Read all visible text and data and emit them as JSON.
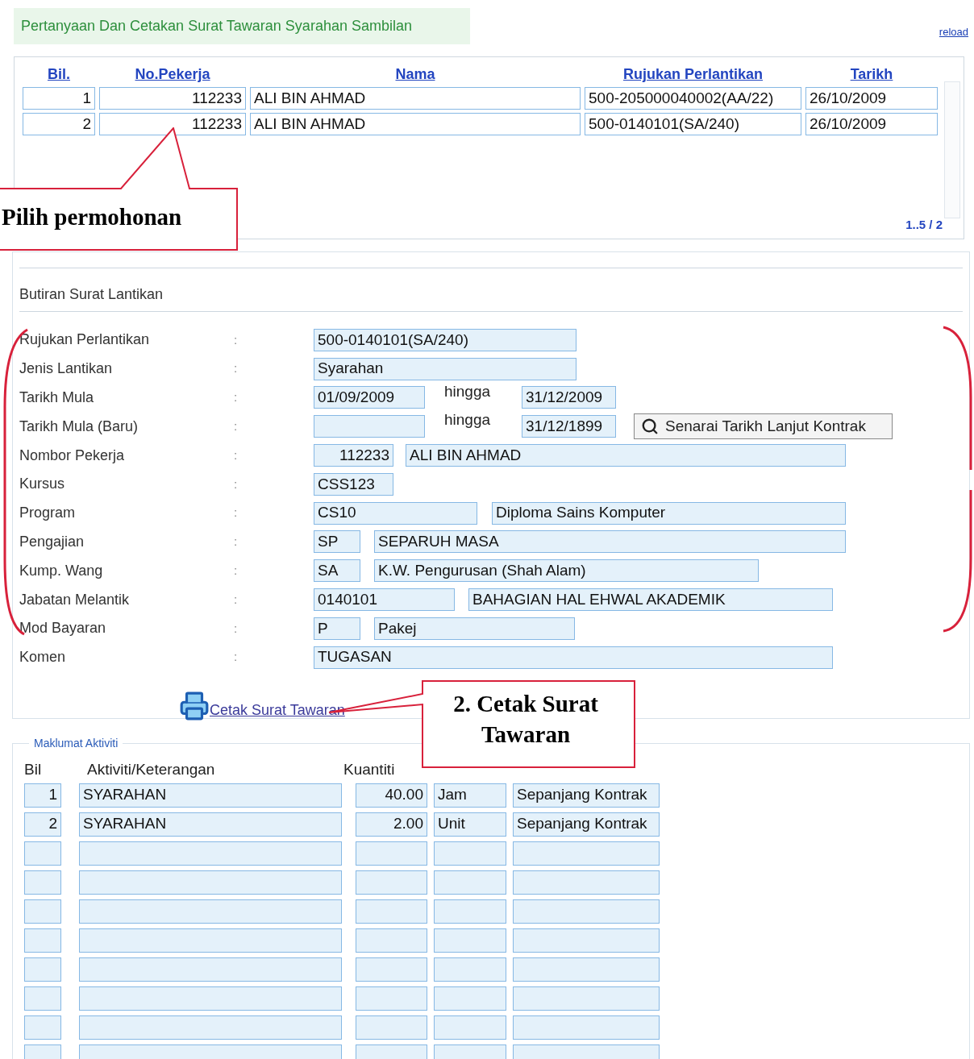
{
  "header": {
    "title": "Pertanyaan Dan Cetakan Surat Tawaran Syarahan Sambilan",
    "reload": "reload"
  },
  "list": {
    "columns": [
      "Bil.",
      "No.Pekerja",
      "Nama",
      "Rujukan Perlantikan",
      "Tarikh"
    ],
    "rows": [
      {
        "cells": [
          "1",
          "112233",
          "ALI BIN AHMAD",
          "500-205000040002(AA/22)",
          "26/10/2009"
        ]
      },
      {
        "cells": [
          "2",
          "112233",
          "ALI BIN AHMAD",
          "500-0140101(SA/240)",
          "26/10/2009"
        ]
      }
    ],
    "pager": "1..5 / 2"
  },
  "details": {
    "title": "Butiran Surat Lantikan",
    "fields": [
      {
        "label": "Rujukan Perlantikan",
        "colon": ":",
        "parts": [
          {
            "kind": "input",
            "value": "500-0140101(SA/240)"
          }
        ]
      },
      {
        "label": "Jenis Lantikan",
        "colon": ":",
        "parts": [
          {
            "kind": "input",
            "value": "Syarahan"
          }
        ]
      },
      {
        "label": "Tarikh Mula",
        "colon": ":",
        "parts": [
          {
            "kind": "input",
            "value": "01/09/2009"
          },
          {
            "kind": "text",
            "value": "hingga"
          },
          {
            "kind": "input",
            "value": "31/12/2009"
          }
        ]
      },
      {
        "label": "Tarikh Mula (Baru)",
        "colon": ":",
        "parts": [
          {
            "kind": "input"
          },
          {
            "kind": "text",
            "value": "hingga"
          },
          {
            "kind": "input",
            "value": "31/12/1899"
          },
          {
            "kind": "button",
            "value": "Senarai Tarikh Lanjut Kontrak"
          }
        ]
      },
      {
        "label": "Nombor Pekerja",
        "colon": ":",
        "parts": [
          {
            "kind": "number",
            "value": "112233"
          },
          {
            "kind": "input",
            "value": "ALI BIN AHMAD"
          }
        ]
      },
      {
        "label": "Kursus",
        "colon": ":",
        "parts": [
          {
            "kind": "input",
            "value": "CSS123"
          }
        ]
      },
      {
        "label": "Program",
        "colon": ":",
        "parts": [
          {
            "kind": "input",
            "value": "CS10"
          },
          {
            "kind": "input",
            "value": "Diploma Sains Komputer"
          }
        ]
      },
      {
        "label": "Pengajian",
        "colon": ":",
        "parts": [
          {
            "kind": "input",
            "value": "SP"
          },
          {
            "kind": "input",
            "value": "SEPARUH MASA"
          }
        ]
      },
      {
        "label": "Kump. Wang",
        "colon": ":",
        "parts": [
          {
            "kind": "input",
            "value": "SA"
          },
          {
            "kind": "input",
            "value": "K.W. Pengurusan (Shah Alam)"
          }
        ]
      },
      {
        "label": "Jabatan Melantik",
        "colon": ":",
        "parts": [
          {
            "kind": "input",
            "value": "0140101"
          },
          {
            "kind": "input",
            "value": "BAHAGIAN HAL EHWAL AKADEMIK"
          }
        ]
      },
      {
        "label": "Mod Bayaran",
        "colon": ":",
        "parts": [
          {
            "kind": "input",
            "value": "P"
          },
          {
            "kind": "input",
            "value": "Pakej"
          }
        ]
      },
      {
        "label": "Komen",
        "colon": ":",
        "parts": [
          {
            "kind": "input",
            "value": "TUGASAN"
          }
        ]
      }
    ],
    "print_link": "Cetak Surat Tawaran"
  },
  "activities": {
    "legend": "Maklumat Aktiviti",
    "columns": [
      "Bil",
      "Aktiviti/Keterangan",
      "Kuantiti"
    ],
    "rows": [
      {
        "kind": "filled",
        "bil": "1",
        "activity": "SYARAHAN",
        "quantity": "40.00",
        "unit": "Jam",
        "period": "Sepanjang Kontrak"
      },
      {
        "kind": "filled",
        "bil": "2",
        "activity": "SYARAHAN",
        "quantity": "2.00",
        "unit": "Unit",
        "period": "Sepanjang Kontrak"
      },
      {
        "kind": "blank"
      },
      {
        "kind": "blank"
      },
      {
        "kind": "blank"
      },
      {
        "kind": "blank"
      },
      {
        "kind": "blank"
      },
      {
        "kind": "blank"
      },
      {
        "kind": "blank"
      },
      {
        "kind": "blank"
      }
    ]
  },
  "annotations": [
    {
      "kind": "callout_top",
      "text": "Pilih permohonan"
    },
    {
      "kind": "callout_print",
      "text": "2.  Cetak Surat Tawaran"
    }
  ]
}
